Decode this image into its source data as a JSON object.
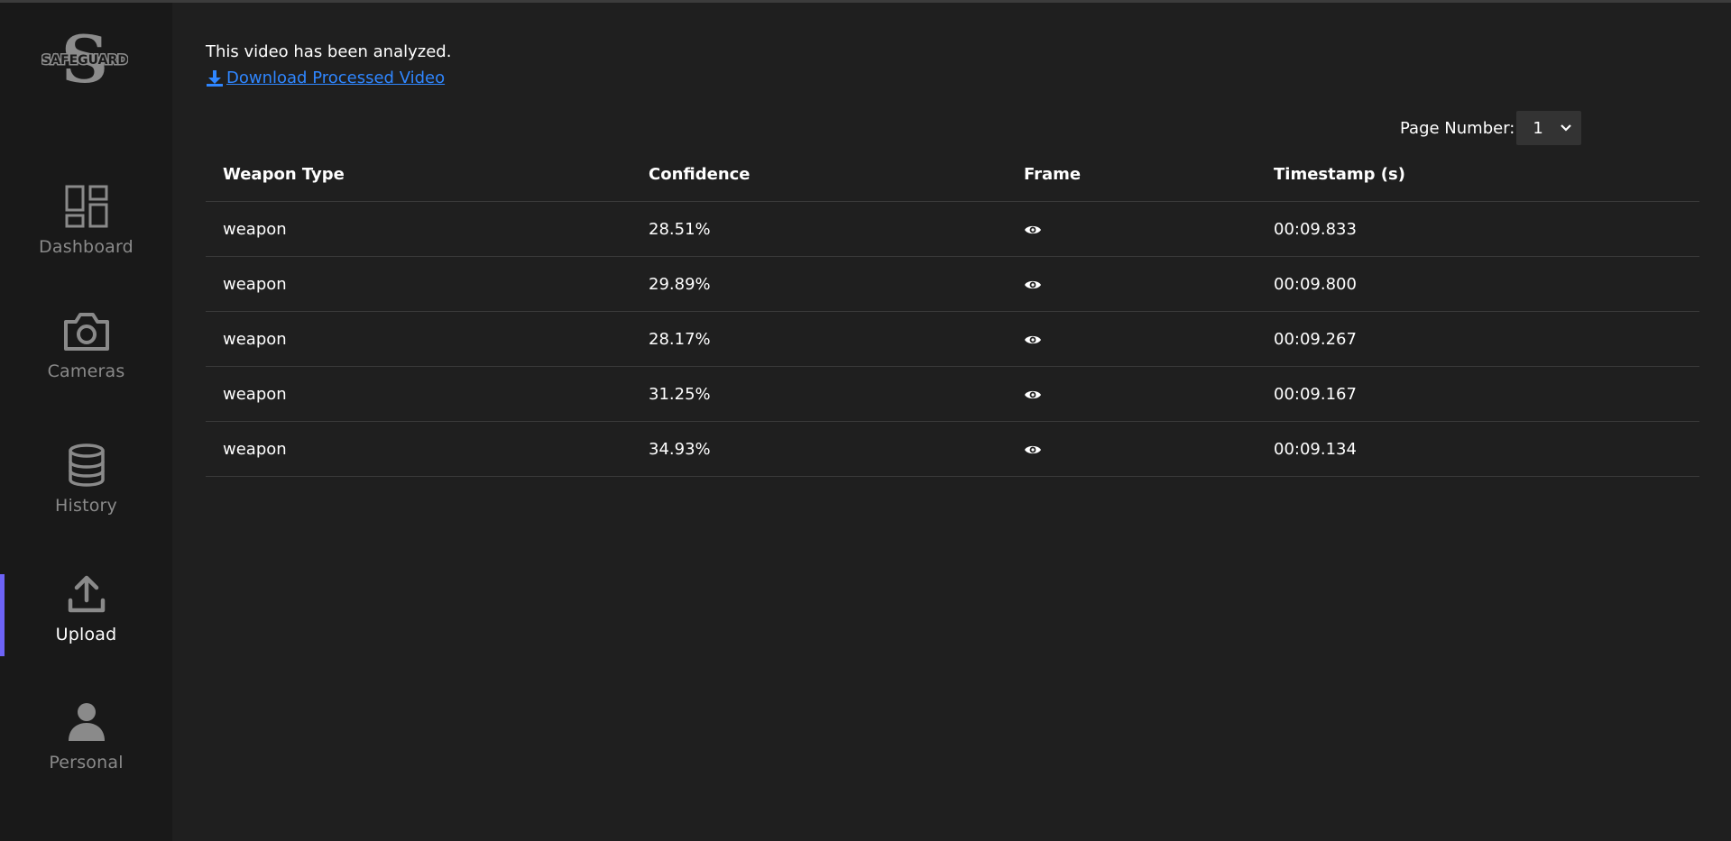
{
  "brand": {
    "logo_text": "SAFEGUARD"
  },
  "sidebar": {
    "items": [
      {
        "label": "Dashboard",
        "icon": "dashboard-icon",
        "active": false
      },
      {
        "label": "Cameras",
        "icon": "camera-icon",
        "active": false
      },
      {
        "label": "History",
        "icon": "database-icon",
        "active": false
      },
      {
        "label": "Upload",
        "icon": "upload-icon",
        "active": true
      },
      {
        "label": "Personal",
        "icon": "person-icon",
        "active": false
      }
    ],
    "accent_color": "#6d63f7"
  },
  "main": {
    "status_text": "This video has been analyzed.",
    "download_label": "Download Processed Video",
    "link_color": "#2f86ff",
    "pager": {
      "label": "Page Number:",
      "selected": "1"
    },
    "table": {
      "headers": [
        "Weapon Type",
        "Confidence",
        "Frame",
        "Timestamp (s)"
      ],
      "rows": [
        {
          "type": "weapon",
          "confidence": "28.51%",
          "frame_icon": "eye-icon",
          "timestamp": "00:09.833"
        },
        {
          "type": "weapon",
          "confidence": "29.89%",
          "frame_icon": "eye-icon",
          "timestamp": "00:09.800"
        },
        {
          "type": "weapon",
          "confidence": "28.17%",
          "frame_icon": "eye-icon",
          "timestamp": "00:09.267"
        },
        {
          "type": "weapon",
          "confidence": "31.25%",
          "frame_icon": "eye-icon",
          "timestamp": "00:09.167"
        },
        {
          "type": "weapon",
          "confidence": "34.93%",
          "frame_icon": "eye-icon",
          "timestamp": "00:09.134"
        }
      ]
    }
  }
}
